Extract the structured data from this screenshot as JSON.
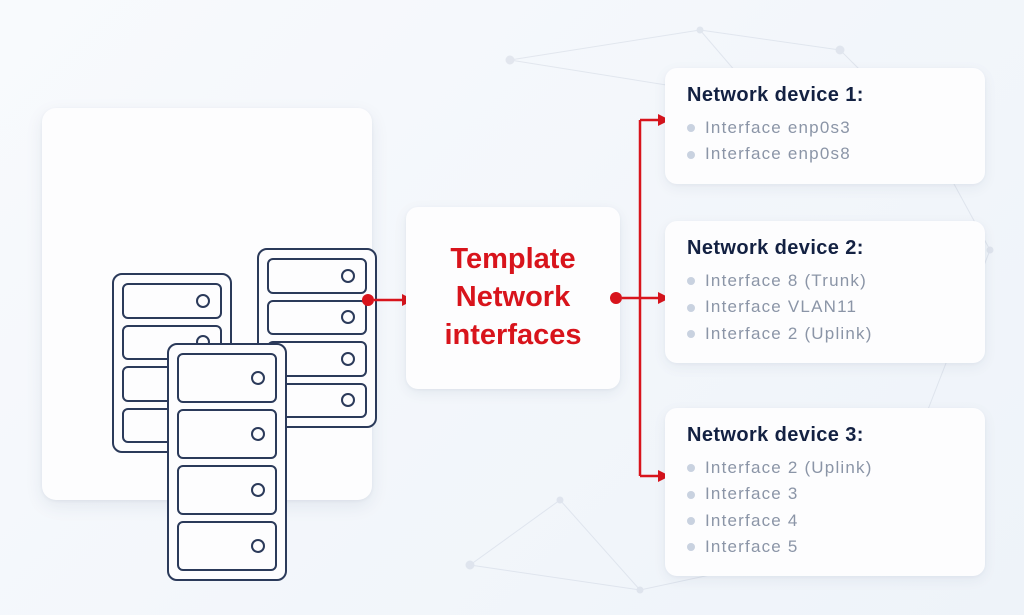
{
  "template": {
    "line1": "Template",
    "line2": "Network",
    "line3": "interfaces"
  },
  "devices": [
    {
      "title": "Network device 1:",
      "interfaces": [
        "Interface enp0s3",
        "Interface enp0s8"
      ]
    },
    {
      "title": "Network device 2:",
      "interfaces": [
        "Interface 8 (Trunk)",
        "Interface VLAN11",
        "Interface 2 (Uplink)"
      ]
    },
    {
      "title": "Network device 3:",
      "interfaces": [
        "Interface 2 (Uplink)",
        "Interface 3",
        "Interface 4",
        "Interface 5"
      ]
    }
  ],
  "colors": {
    "accent": "#d8141c",
    "text_dark": "#132142",
    "text_muted": "#8b95a7"
  }
}
